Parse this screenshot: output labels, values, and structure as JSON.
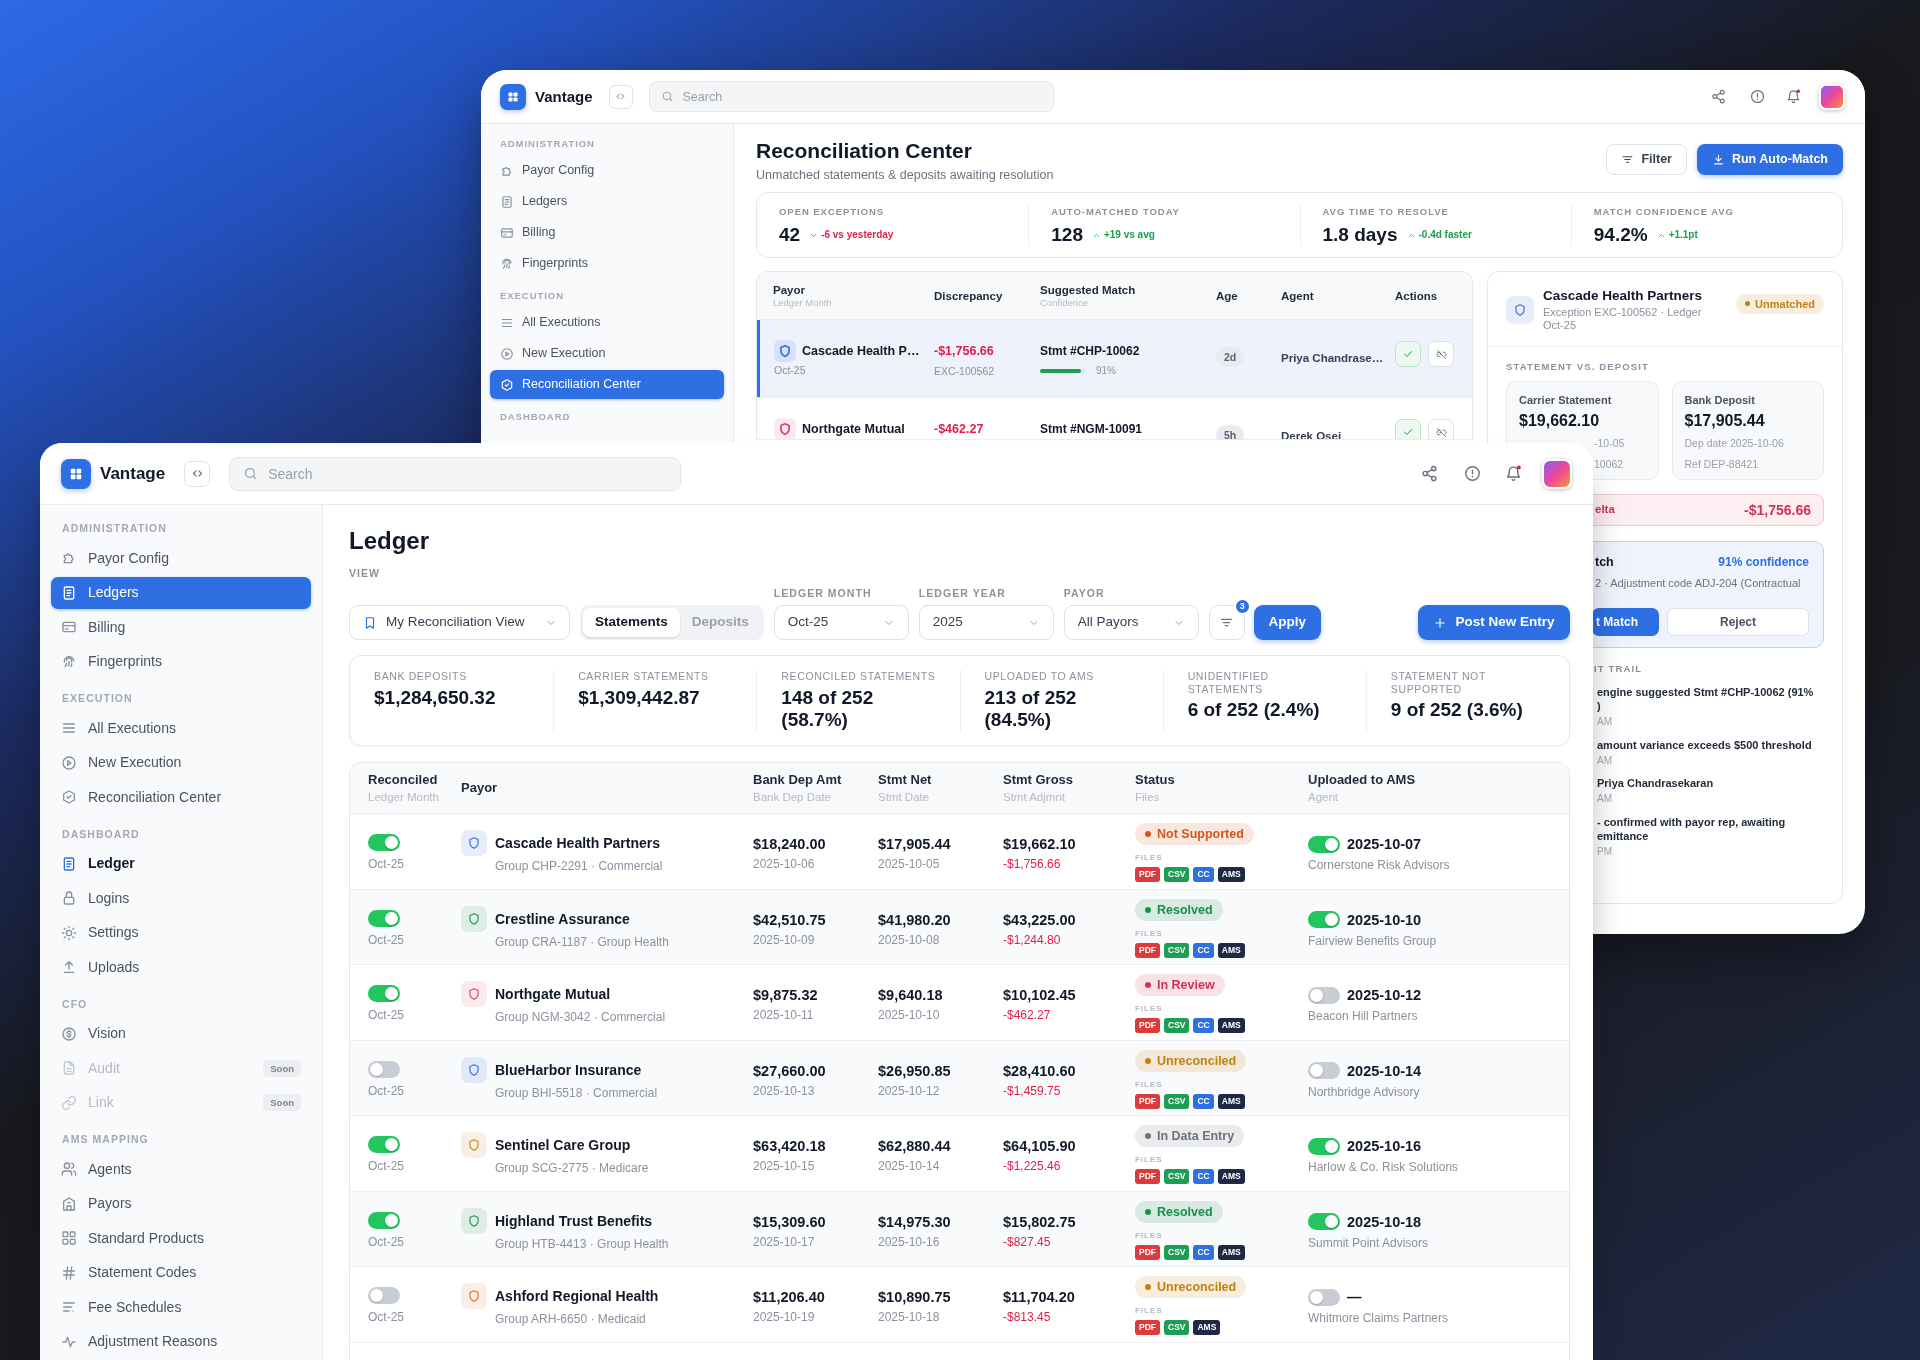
{
  "back_window": {
    "header": {
      "brand": "Vantage",
      "search": {
        "placeholder": "Search"
      }
    },
    "sidebar": [
      {
        "title": "ADMINISTRATION",
        "items": [
          {
            "label": "Payor Config",
            "selected": false
          },
          {
            "label": "Ledgers",
            "selected": false
          },
          {
            "label": "Billing",
            "selected": false
          },
          {
            "label": "Fingerprints",
            "selected": false
          }
        ]
      },
      {
        "title": "EXECUTION",
        "items": [
          {
            "label": "All Executions",
            "selected": false
          },
          {
            "label": "New Execution",
            "selected": false
          },
          {
            "label": "Reconciliation Center",
            "selected": true
          }
        ]
      },
      {
        "title": "DASHBOARD"
      }
    ],
    "page": {
      "title": "Reconciliation Center",
      "subtitle": "Unmatched statements & deposits awaiting resolution",
      "buttons": [
        {
          "label": "Filter",
          "kind": "secondary"
        },
        {
          "label": "Run Auto-Match",
          "kind": "primary"
        }
      ]
    },
    "stats": [
      {
        "label": "OPEN EXCEPTIONS",
        "value": "42",
        "change": "-6 vs yesterday",
        "up": false
      },
      {
        "label": "AUTO-MATCHED TODAY",
        "value": "128",
        "change": "+19 vs avg",
        "up": true
      },
      {
        "label": "AVG TIME TO RESOLVE",
        "value": "1.8 days",
        "change": "-0.4d faster",
        "up": true
      },
      {
        "label": "MATCH CONFIDENCE AVG",
        "value": "94.2%",
        "change": "+1.1pt",
        "up": true
      }
    ],
    "exceptions_table": {
      "columns": [
        {
          "title": "Payor",
          "subtitle": "Ledger Month"
        },
        {
          "title": "Discrepancy"
        },
        {
          "title": "Suggested Match",
          "subtitle": "Confidence"
        },
        {
          "title": "Age"
        },
        {
          "title": "Agent"
        },
        {
          "title": "Actions"
        }
      ],
      "rows": [
        {
          "selected": true,
          "payor": "Cascade Health P…",
          "color": "#3b6fe0",
          "ledger_month": "Oct-25",
          "discrepancy": "-$1,756.66",
          "exception_id": "EXC-100562",
          "suggested_match": "Stmt #CHP-10062",
          "confidence": {
            "level": 0.91,
            "reading": "91%"
          },
          "age": "2d",
          "agent": "Priya Chandrase…"
        },
        {
          "selected": false,
          "payor": "Northgate Mutual",
          "color": "#d9466b",
          "discrepancy": "-$462.27",
          "suggested_match": "Stmt #NGM-10091",
          "age": "5h",
          "agent": "Derek Osei"
        }
      ]
    },
    "detail_panel": {
      "title": "Cascade Health Partners",
      "subtitle": "Exception EXC-100562 · Ledger Oct-25",
      "status": {
        "label": "Unmatched",
        "color": "#c47f12"
      },
      "section_title": "STATEMENT VS. DEPOSIT",
      "cards": [
        {
          "title": "Carrier Statement",
          "amount": "$19,662.10",
          "lines": [
            "-10-05",
            "10062"
          ]
        },
        {
          "title": "Bank Deposit",
          "amount": "$17,905.44",
          "lines": [
            "Dep date 2025-10-06",
            "Ref DEP-88421"
          ]
        }
      ],
      "delta": {
        "label": "elta",
        "amount": "-$1,756.66"
      },
      "suggestion": {
        "title": "tch",
        "confidence": "91% confidence",
        "detail": "2 · Adjustment code ADJ-204 (Contractual",
        "buttons": [
          {
            "label": "t Match",
            "kind": "primary"
          },
          {
            "label": "Reject",
            "kind": "secondary"
          }
        ]
      },
      "audit_title": "IT TRAIL",
      "audit": [
        {
          "lines": [
            "engine suggested Stmt #CHP-10062 (91%",
            ")"
          ],
          "time": "AM"
        },
        {
          "lines": [
            "amount variance exceeds $500 threshold"
          ],
          "time": "AM"
        },
        {
          "lines": [
            "Priya Chandrasekaran"
          ],
          "time": "AM"
        },
        {
          "lines": [
            "- confirmed with payor rep, awaiting",
            "emittance"
          ],
          "time": "PM"
        }
      ]
    }
  },
  "front_window": {
    "header": {
      "brand": "Vantage",
      "search": {
        "placeholder": "Search"
      }
    },
    "sidebar": [
      {
        "title": "ADMINISTRATION",
        "items": [
          {
            "label": "Payor Config",
            "selected": false,
            "active": false,
            "disabled": false
          },
          {
            "label": "Ledgers",
            "selected": true,
            "active": false,
            "disabled": false
          },
          {
            "label": "Billing",
            "selected": false,
            "active": false,
            "disabled": false
          },
          {
            "label": "Fingerprints",
            "selected": false,
            "active": false,
            "disabled": false
          }
        ]
      },
      {
        "title": "EXECUTION",
        "items": [
          {
            "label": "All Executions",
            "selected": false,
            "active": false,
            "disabled": false
          },
          {
            "label": "New Execution",
            "selected": false,
            "active": false,
            "disabled": false
          },
          {
            "label": "Reconciliation Center",
            "selected": false,
            "active": false,
            "disabled": false
          }
        ]
      },
      {
        "title": "DASHBOARD",
        "items": [
          {
            "label": "Ledger",
            "selected": false,
            "active": true,
            "disabled": false
          },
          {
            "label": "Logins",
            "selected": false,
            "active": false,
            "disabled": false
          },
          {
            "label": "Settings",
            "selected": false,
            "active": false,
            "disabled": false
          },
          {
            "label": "Uploads",
            "selected": false,
            "active": false,
            "disabled": false
          }
        ]
      },
      {
        "title": "CFO",
        "items": [
          {
            "label": "Vision",
            "selected": false,
            "active": false,
            "disabled": false
          },
          {
            "label": "Audit",
            "selected": false,
            "active": false,
            "disabled": true,
            "badge": "Soon"
          },
          {
            "label": "Link",
            "selected": false,
            "active": false,
            "disabled": true,
            "badge": "Soon"
          }
        ]
      },
      {
        "title": "AMS MAPPING",
        "items": [
          {
            "label": "Agents",
            "selected": false,
            "active": false,
            "disabled": false
          },
          {
            "label": "Payors",
            "selected": false,
            "active": false,
            "disabled": false
          },
          {
            "label": "Standard Products",
            "selected": false,
            "active": false,
            "disabled": false
          },
          {
            "label": "Statement Codes",
            "selected": false,
            "active": false,
            "disabled": false
          },
          {
            "label": "Fee Schedules",
            "selected": false,
            "active": false,
            "disabled": false
          },
          {
            "label": "Adjustment Reasons",
            "selected": false,
            "active": false,
            "disabled": false
          }
        ]
      }
    ],
    "page": {
      "title": "Ledger"
    },
    "filters": {
      "view_label": "VIEW",
      "view": "My Reconciliation View",
      "tabs": [
        {
          "label": "Statements",
          "selected": true
        },
        {
          "label": "Deposits",
          "selected": false
        }
      ],
      "fields": [
        {
          "label": "LEDGER MONTH",
          "value": "Oct-25"
        },
        {
          "label": "LEDGER YEAR",
          "value": "2025"
        },
        {
          "label": "PAYOR",
          "value": "All Payors"
        }
      ],
      "filter_count": "3",
      "apply": "Apply",
      "post": "Post New Entry"
    },
    "summary": [
      {
        "label": "BANK DEPOSITS",
        "value": "$1,284,650.32"
      },
      {
        "label": "CARRIER STATEMENTS",
        "value": "$1,309,442.87"
      },
      {
        "label": "RECONCILED STATEMENTS",
        "value": "148 of 252 (58.7%)"
      },
      {
        "label": "UPLOADED TO AMS",
        "value": "213 of 252 (84.5%)"
      },
      {
        "label": "UNIDENTIFIED STATEMENTS",
        "value": "6 of 252 (2.4%)"
      },
      {
        "label": "STATEMENT NOT SUPPORTED",
        "value": "9 of 252 (3.6%)"
      }
    ],
    "ledger_table": {
      "columns": [
        {
          "title": "Reconciled",
          "subtitle": "Ledger Month"
        },
        {
          "title": "Payor"
        },
        {
          "title": "Bank Dep Amt",
          "subtitle": "Bank Dep Date"
        },
        {
          "title": "Stmt Net",
          "subtitle": "Stmt Date"
        },
        {
          "title": "Stmt Gross",
          "subtitle": "Stmt Adjmnt"
        },
        {
          "title": "Status",
          "subtitle": "Files"
        },
        {
          "title": "Uploaded to AMS",
          "subtitle": "Agent"
        }
      ],
      "rows": [
        {
          "reconciled": true,
          "ledger_month": "Oct-25",
          "payor": {
            "name": "Cascade Health Partners",
            "group": "Group CHP-2291 · Commercial",
            "color": "#3b6fe0"
          },
          "bank_dep_amt": "$18,240.00",
          "bank_dep_date": "2025-10-06",
          "stmt_net": "$17,905.44",
          "stmt_date": "2025-10-05",
          "stmt_gross": "$19,662.10",
          "stmt_adjmnt": "-$1,756.66",
          "status": {
            "label": "Not Supported",
            "color": "#d4561c"
          },
          "files_label": "FILES",
          "files": [
            {
              "label": "PDF",
              "kind": "pdf"
            },
            {
              "label": "CSV",
              "kind": "csv"
            },
            {
              "label": "CC",
              "kind": "cc"
            },
            {
              "label": "AMS",
              "kind": "ams"
            }
          ],
          "uploaded": true,
          "uploaded_date": "2025-10-07",
          "agent": "Cornerstone Risk Advisors"
        },
        {
          "reconciled": true,
          "ledger_month": "Oct-25",
          "payor": {
            "name": "Crestline Assurance",
            "group": "Group CRA-1187 · Group Health",
            "color": "#23945a"
          },
          "bank_dep_amt": "$42,510.75",
          "bank_dep_date": "2025-10-09",
          "stmt_net": "$41,980.20",
          "stmt_date": "2025-10-08",
          "stmt_gross": "$43,225.00",
          "stmt_adjmnt": "-$1,244.80",
          "status": {
            "label": "Resolved",
            "color": "#17904a"
          },
          "files_label": "FILES",
          "files": [
            {
              "label": "PDF",
              "kind": "pdf"
            },
            {
              "label": "CSV",
              "kind": "csv"
            },
            {
              "label": "CC",
              "kind": "cc"
            },
            {
              "label": "AMS",
              "kind": "ams"
            }
          ],
          "uploaded": true,
          "uploaded_date": "2025-10-10",
          "agent": "Fairview Benefits Group"
        },
        {
          "reconciled": true,
          "ledger_month": "Oct-25",
          "payor": {
            "name": "Northgate Mutual",
            "group": "Group NGM-3042 · Commercial",
            "color": "#d9466b"
          },
          "bank_dep_amt": "$9,875.32",
          "bank_dep_date": "2025-10-11",
          "stmt_net": "$9,640.18",
          "stmt_date": "2025-10-10",
          "stmt_gross": "$10,102.45",
          "stmt_adjmnt": "-$462.27",
          "status": {
            "label": "In Review",
            "color": "#d0335a"
          },
          "files_label": "FILES",
          "files": [
            {
              "label": "PDF",
              "kind": "pdf"
            },
            {
              "label": "CSV",
              "kind": "csv"
            },
            {
              "label": "CC",
              "kind": "cc"
            },
            {
              "label": "AMS",
              "kind": "ams"
            }
          ],
          "uploaded": false,
          "uploaded_date": "2025-10-12",
          "agent": "Beacon Hill Partners"
        },
        {
          "reconciled": false,
          "ledger_month": "Oct-25",
          "payor": {
            "name": "BlueHarbor Insurance",
            "group": "Group BHI-5518 · Commercial",
            "color": "#3b6fe0"
          },
          "bank_dep_amt": "$27,660.00",
          "bank_dep_date": "2025-10-13",
          "stmt_net": "$26,950.85",
          "stmt_date": "2025-10-12",
          "stmt_gross": "$28,410.60",
          "stmt_adjmnt": "-$1,459.75",
          "status": {
            "label": "Unreconciled",
            "color": "#c47f12"
          },
          "files_label": "FILES",
          "files": [
            {
              "label": "PDF",
              "kind": "pdf"
            },
            {
              "label": "CSV",
              "kind": "csv"
            },
            {
              "label": "CC",
              "kind": "cc"
            },
            {
              "label": "AMS",
              "kind": "ams"
            }
          ],
          "uploaded": false,
          "uploaded_date": "2025-10-14",
          "agent": "Northbridge Advisory"
        },
        {
          "reconciled": true,
          "ledger_month": "Oct-25",
          "payor": {
            "name": "Sentinel Care Group",
            "group": "Group SCG-2775 · Medicare",
            "color": "#c98a1a"
          },
          "bank_dep_amt": "$63,420.18",
          "bank_dep_date": "2025-10-15",
          "stmt_net": "$62,880.44",
          "stmt_date": "2025-10-14",
          "stmt_gross": "$64,105.90",
          "stmt_adjmnt": "-$1,225.46",
          "status": {
            "label": "In Data Entry",
            "color": "#6b7280"
          },
          "files_label": "FILES",
          "files": [
            {
              "label": "PDF",
              "kind": "pdf"
            },
            {
              "label": "CSV",
              "kind": "csv"
            },
            {
              "label": "CC",
              "kind": "cc"
            },
            {
              "label": "AMS",
              "kind": "ams"
            }
          ],
          "uploaded": true,
          "uploaded_date": "2025-10-16",
          "agent": "Harlow & Co. Risk Solutions"
        },
        {
          "reconciled": true,
          "ledger_month": "Oct-25",
          "payor": {
            "name": "Highland Trust Benefits",
            "group": "Group HTB-4413 · Group Health",
            "color": "#23945a"
          },
          "bank_dep_amt": "$15,309.60",
          "bank_dep_date": "2025-10-17",
          "stmt_net": "$14,975.30",
          "stmt_date": "2025-10-16",
          "stmt_gross": "$15,802.75",
          "stmt_adjmnt": "-$827.45",
          "status": {
            "label": "Resolved",
            "color": "#17904a"
          },
          "files_label": "FILES",
          "files": [
            {
              "label": "PDF",
              "kind": "pdf"
            },
            {
              "label": "CSV",
              "kind": "csv"
            },
            {
              "label": "CC",
              "kind": "cc"
            },
            {
              "label": "AMS",
              "kind": "ams"
            }
          ],
          "uploaded": true,
          "uploaded_date": "2025-10-18",
          "agent": "Summit Point Advisors"
        },
        {
          "reconciled": false,
          "ledger_month": "Oct-25",
          "payor": {
            "name": "Ashford Regional Health",
            "group": "Group ARH-6650 · Medicaid",
            "color": "#e07034"
          },
          "bank_dep_amt": "$11,206.40",
          "bank_dep_date": "2025-10-19",
          "stmt_net": "$10,890.75",
          "stmt_date": "2025-10-18",
          "stmt_gross": "$11,704.20",
          "stmt_adjmnt": "-$813.45",
          "status": {
            "label": "Unreconciled",
            "color": "#c47f12"
          },
          "files_label": "FILES",
          "files": [
            {
              "label": "PDF",
              "kind": "pdf"
            },
            {
              "label": "CSV",
              "kind": "csv"
            },
            {
              "label": "AMS",
              "kind": "ams"
            }
          ],
          "uploaded": false,
          "uploaded_date": "—",
          "agent": "Whitmore Claims Partners"
        }
      ]
    }
  }
}
